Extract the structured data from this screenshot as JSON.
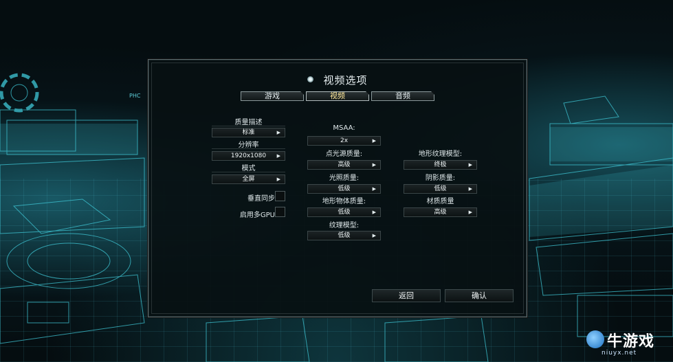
{
  "window_title": "视频选项",
  "tabs": [
    {
      "label": "游戏",
      "active": false
    },
    {
      "label": "视频",
      "active": true
    },
    {
      "label": "音频",
      "active": false
    }
  ],
  "left_settings": {
    "quality_preset": {
      "label": "质量描述",
      "value": "标准"
    },
    "resolution": {
      "label": "分辨率",
      "value": "1920x1080"
    },
    "mode": {
      "label": "模式",
      "value": "全屏"
    },
    "vsync": {
      "label": "垂直同步",
      "checked": false
    },
    "multi_gpu": {
      "label": "启用多GPU",
      "checked": false
    }
  },
  "middle_settings": {
    "msaa": {
      "label": "MSAA:",
      "value": "2x"
    },
    "point_light": {
      "label": "点光源质量:",
      "value": "高级"
    },
    "lighting": {
      "label": "光照质量:",
      "value": "低级"
    },
    "terrain_objects": {
      "label": "地形物体质量:",
      "value": "低级"
    },
    "texture_model": {
      "label": "纹理模型:",
      "value": "低级"
    }
  },
  "right_settings": {
    "terrain_texture": {
      "label": "地形纹理模型:",
      "value": "终极"
    },
    "shadow": {
      "label": "阴影质量:",
      "value": "低级"
    },
    "material": {
      "label": "材质质量",
      "value": "高级"
    }
  },
  "buttons": {
    "back": "返回",
    "confirm": "确认"
  },
  "watermark": {
    "brand": "牛游戏",
    "url": "niuyx.net"
  },
  "colors": {
    "active_tab_text": "#ffe89a",
    "hologram": "#3fc7d6"
  }
}
